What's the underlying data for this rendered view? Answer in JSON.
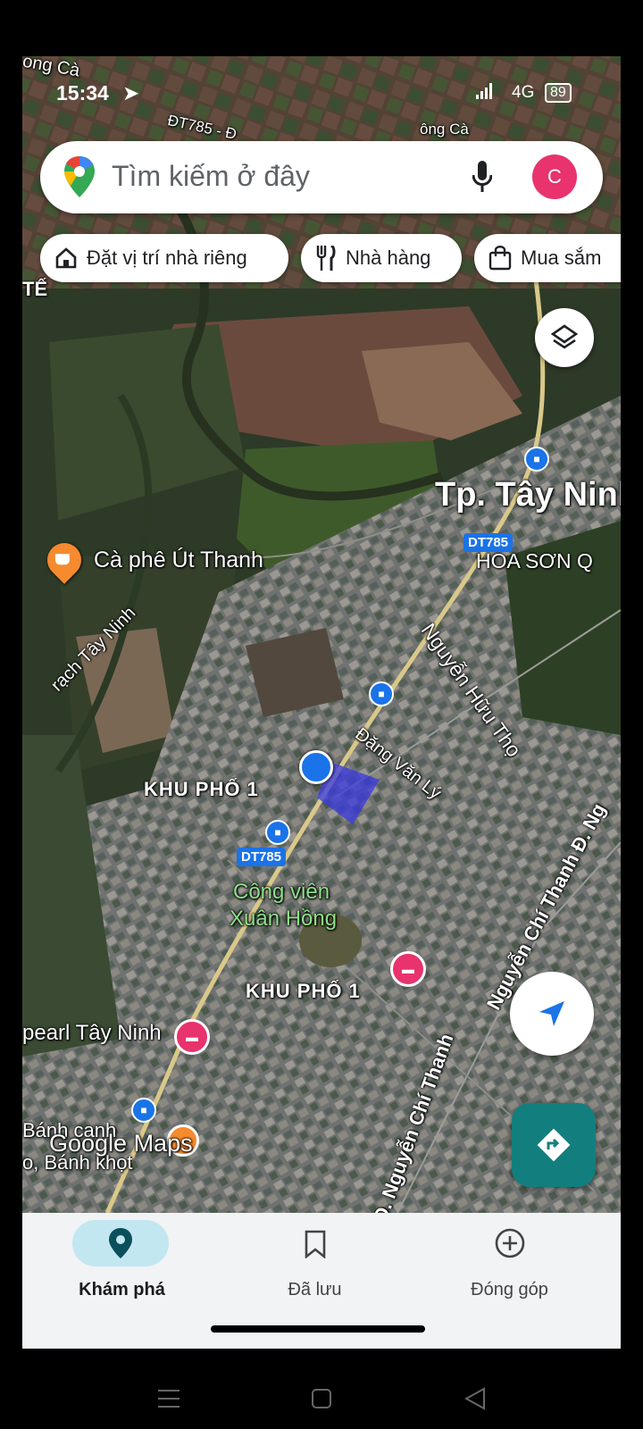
{
  "status": {
    "time": "15:34",
    "network": "4G",
    "battery": "89"
  },
  "search": {
    "placeholder": "Tìm kiếm ở đây",
    "avatar_letter": "C"
  },
  "chips": [
    {
      "label": "Đặt vị trí nhà riêng",
      "icon": "home-icon"
    },
    {
      "label": "Nhà hàng",
      "icon": "restaurant-icon"
    },
    {
      "label": "Mua sắm",
      "icon": "shopping-bag-icon"
    }
  ],
  "map": {
    "labels": {
      "top_left": "ong Cà",
      "road_top": "ĐT785 - Đ",
      "top_right": "ông Cà",
      "te": "TẾ",
      "city": "Tp. Tây Ninh",
      "hoa_son": "HOA SƠN Q",
      "cafe": "Cà phê Út Thanh",
      "canal": "rạch Tây Ninh",
      "nguyen_huu_tho": "Nguyễn Hữu Thọ",
      "dang_van_ly": "Đặng Văn Lý",
      "khu_pho_1a": "KHU PHỐ 1",
      "park_line1": "Công viên",
      "park_line2": "Xuân Hồng",
      "khu_pho_1b": "KHU PHỐ 1",
      "pearl": "pearl Tây Ninh",
      "nguyen_chi_thanh_1": "Đ. Nguyễn Chí Thanh",
      "nguyen_chi_thanh_2": "Nguyễn Chí Thanh Đ. Ng",
      "banh_canh_1": "Bánh canh",
      "banh_canh_2": "o, Bánh khọt",
      "watermark": "Google Maps"
    },
    "route_badges": [
      "DT785",
      "DT785"
    ]
  },
  "bottom_nav": [
    {
      "label": "Khám phá",
      "icon": "explore-pin-icon",
      "active": true
    },
    {
      "label": "Đã lưu",
      "icon": "bookmark-icon",
      "active": false
    },
    {
      "label": "Đóng góp",
      "icon": "add-circle-icon",
      "active": false
    }
  ],
  "colors": {
    "accent": "#1a73e8",
    "active_tab_bg": "#c2e7f0",
    "avatar": "#e8336d",
    "directions": "#137e7e",
    "route_badge": "#1a73e8"
  }
}
